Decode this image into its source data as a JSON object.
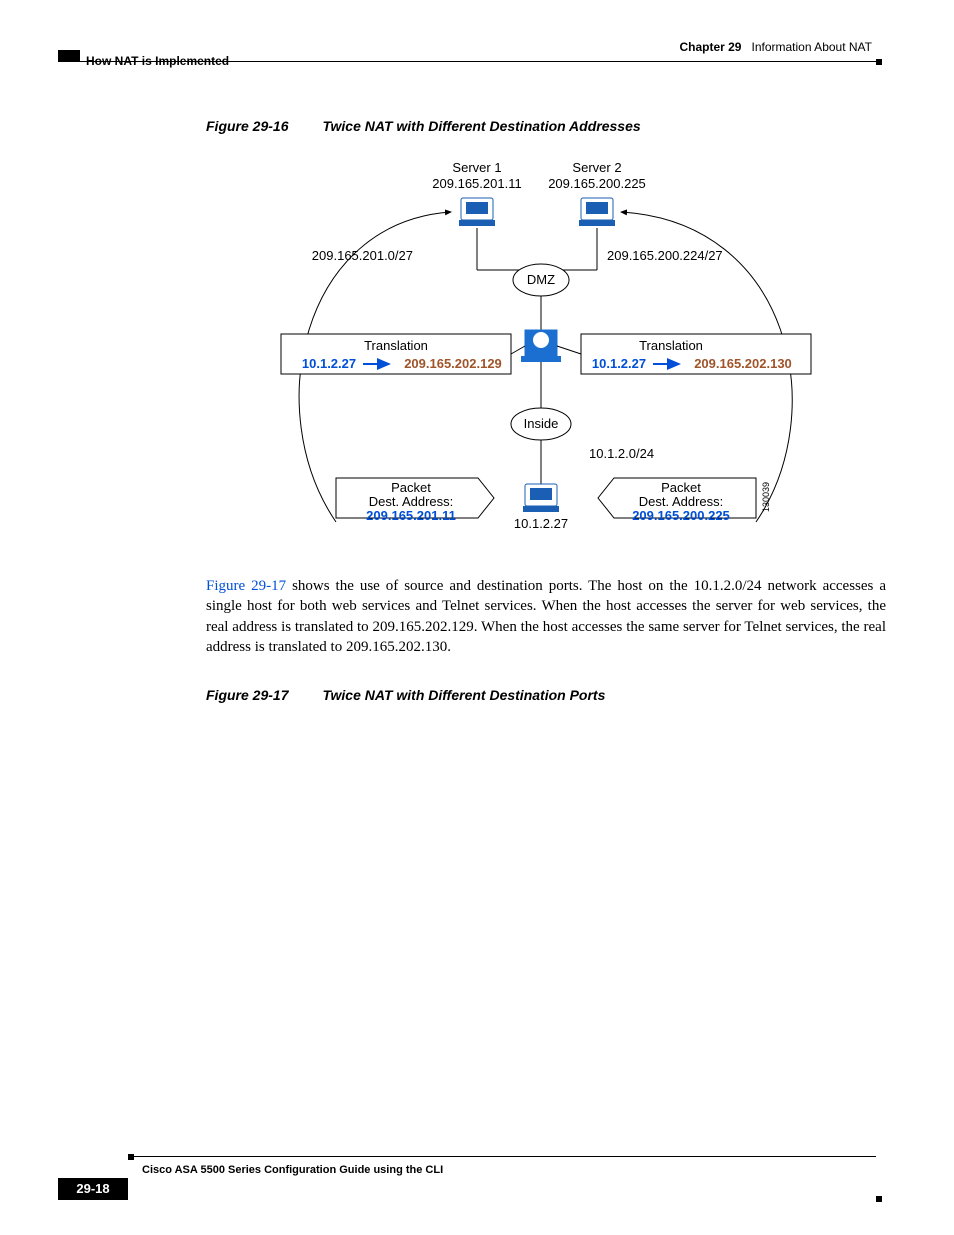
{
  "header": {
    "chapter": "Chapter 29",
    "title": "Information About NAT",
    "section": "How NAT is Implemented"
  },
  "fig16": {
    "caption_no": "Figure 29-16",
    "caption_txt": "Twice NAT with Different Destination Addresses",
    "server1": "Server 1",
    "server1_ip": "209.165.201.11",
    "server2": "Server 2",
    "server2_ip": "209.165.200.225",
    "net_left": "209.165.201.0/27",
    "net_right": "209.165.200.224/27",
    "dmz": "DMZ",
    "inside": "Inside",
    "inside_net": "10.1.2.0/24",
    "host": "10.1.2.27",
    "tl_title": "Translation",
    "tl_from": "10.1.2.27",
    "tl_to": "209.165.202.129",
    "tr_title": "Translation",
    "tr_from": "10.1.2.27",
    "tr_to": "209.165.202.130",
    "pl_1": "Packet",
    "pl_2": "Dest. Address:",
    "pl_3": "209.165.201.11",
    "pr_1": "Packet",
    "pr_2": "Dest. Address:",
    "pr_3": "209.165.200.225",
    "imgid": "130039"
  },
  "para": {
    "ref": "Figure 29-17",
    "rest": " shows the use of source and destination ports. The host on the 10.1.2.0/24 network accesses a single host for both web services and Telnet services. When the host accesses the server for web services, the real address is translated to 209.165.202.129. When the host accesses the same server for Telnet services, the real address is translated to 209.165.202.130."
  },
  "fig17": {
    "caption_no": "Figure 29-17",
    "caption_txt": "Twice NAT with Different Destination Ports"
  },
  "footer": {
    "guide": "Cisco ASA 5500 Series Configuration Guide using the CLI",
    "page": "29-18"
  }
}
